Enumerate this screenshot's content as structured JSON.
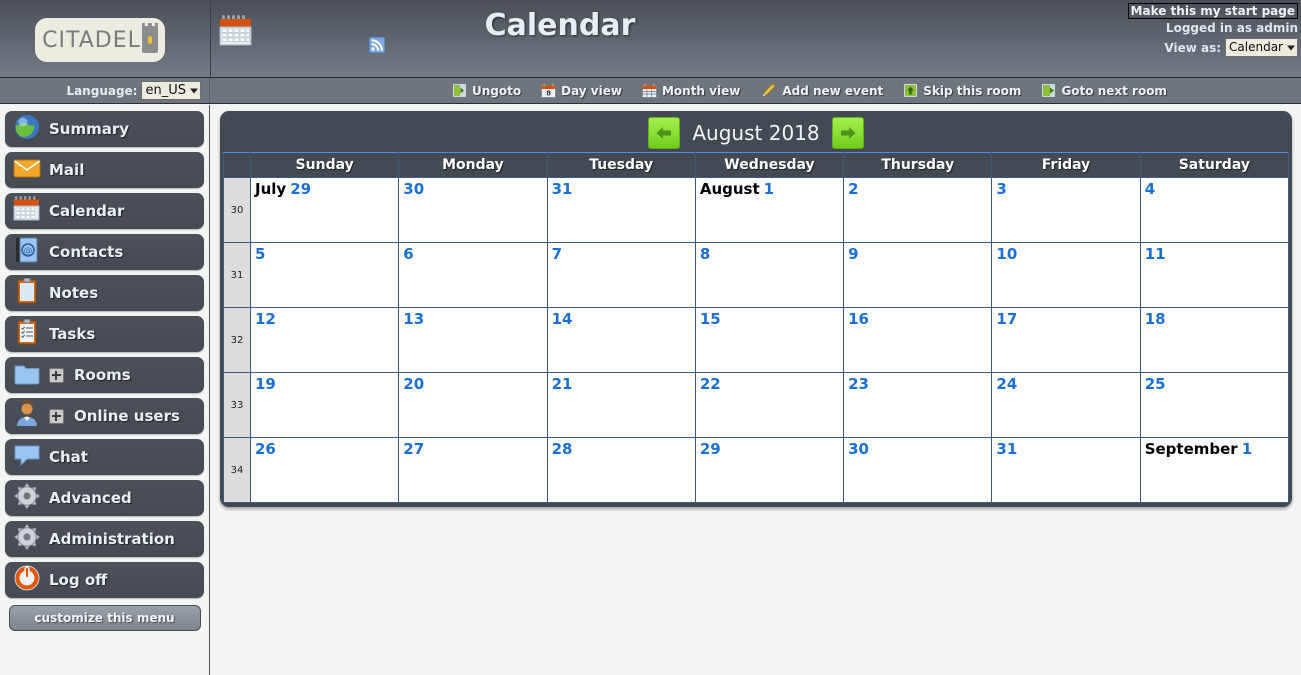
{
  "banner": {
    "logo_text": "CITADEL",
    "calendar_icon": "calendar-icon",
    "title": "Calendar",
    "rss_icon": "rss-icon",
    "start_page_link": "Make this my start page",
    "logged_in_text": "Logged in as admin",
    "view_as_label": "View as:",
    "view_as_value": "Calendar"
  },
  "strip": {
    "language_label": "Language:",
    "language_value": "en_US",
    "toolbar": [
      {
        "label": "Ungoto",
        "icon": "ungoto-icon"
      },
      {
        "label": "Day view",
        "icon": "day-view-icon"
      },
      {
        "label": "Month view",
        "icon": "month-view-icon"
      },
      {
        "label": "Add new event",
        "icon": "pencil-icon"
      },
      {
        "label": "Skip this room",
        "icon": "skip-room-icon"
      },
      {
        "label": "Goto next room",
        "icon": "next-room-icon"
      }
    ]
  },
  "sidebar": {
    "items": [
      {
        "label": "Summary",
        "icon": "globe-icon",
        "expandable": false
      },
      {
        "label": "Mail",
        "icon": "envelope-icon",
        "expandable": false
      },
      {
        "label": "Calendar",
        "icon": "calendar-icon",
        "expandable": false
      },
      {
        "label": "Contacts",
        "icon": "address-book-icon",
        "expandable": false
      },
      {
        "label": "Notes",
        "icon": "clipboard-icon",
        "expandable": false
      },
      {
        "label": "Tasks",
        "icon": "checklist-icon",
        "expandable": false
      },
      {
        "label": "Rooms",
        "icon": "folder-icon",
        "expandable": true
      },
      {
        "label": "Online users",
        "icon": "user-icon",
        "expandable": true
      },
      {
        "label": "Chat",
        "icon": "chat-bubble-icon",
        "expandable": false
      },
      {
        "label": "Advanced",
        "icon": "gear-icon",
        "expandable": false
      },
      {
        "label": "Administration",
        "icon": "gear-icon",
        "expandable": false
      },
      {
        "label": "Log off",
        "icon": "power-icon",
        "expandable": false
      }
    ],
    "customize_label": "customize this menu"
  },
  "calendar": {
    "title": "August 2018",
    "prev_icon": "arrow-left-icon",
    "next_icon": "arrow-right-icon",
    "weeknum_header": "",
    "day_headers": [
      "Sunday",
      "Monday",
      "Tuesday",
      "Wednesday",
      "Thursday",
      "Friday",
      "Saturday"
    ],
    "weeks": [
      {
        "number": "30",
        "days": [
          {
            "month": "July",
            "day": "29",
            "state": "othermonth"
          },
          {
            "month": "",
            "day": "30",
            "state": "othermonth"
          },
          {
            "month": "",
            "day": "31",
            "state": "othermonth"
          },
          {
            "month": "August",
            "day": "1",
            "state": "normal"
          },
          {
            "month": "",
            "day": "2",
            "state": "normal"
          },
          {
            "month": "",
            "day": "3",
            "state": "normal"
          },
          {
            "month": "",
            "day": "4",
            "state": "weekend"
          }
        ]
      },
      {
        "number": "31",
        "days": [
          {
            "month": "",
            "day": "5",
            "state": "weekend"
          },
          {
            "month": "",
            "day": "6",
            "state": "normal"
          },
          {
            "month": "",
            "day": "7",
            "state": "normal"
          },
          {
            "month": "",
            "day": "8",
            "state": "normal"
          },
          {
            "month": "",
            "day": "9",
            "state": "normal"
          },
          {
            "month": "",
            "day": "10",
            "state": "normal"
          },
          {
            "month": "",
            "day": "11",
            "state": "weekend"
          }
        ]
      },
      {
        "number": "32",
        "days": [
          {
            "month": "",
            "day": "12",
            "state": "weekend"
          },
          {
            "month": "",
            "day": "13",
            "state": "normal"
          },
          {
            "month": "",
            "day": "14",
            "state": "normal"
          },
          {
            "month": "",
            "day": "15",
            "state": "normal"
          },
          {
            "month": "",
            "day": "16",
            "state": "normal"
          },
          {
            "month": "",
            "day": "17",
            "state": "normal"
          },
          {
            "month": "",
            "day": "18",
            "state": "weekend"
          }
        ]
      },
      {
        "number": "33",
        "days": [
          {
            "month": "",
            "day": "19",
            "state": "weekend"
          },
          {
            "month": "",
            "day": "20",
            "state": "normal"
          },
          {
            "month": "",
            "day": "21",
            "state": "normal"
          },
          {
            "month": "",
            "day": "22",
            "state": "normal"
          },
          {
            "month": "",
            "day": "23",
            "state": "normal"
          },
          {
            "month": "",
            "day": "24",
            "state": "normal"
          },
          {
            "month": "",
            "day": "25",
            "state": "weekend"
          }
        ]
      },
      {
        "number": "34",
        "days": [
          {
            "month": "",
            "day": "26",
            "state": "weekend"
          },
          {
            "month": "",
            "day": "27",
            "state": "normal"
          },
          {
            "month": "",
            "day": "28",
            "state": "normal"
          },
          {
            "month": "",
            "day": "29",
            "state": "normal"
          },
          {
            "month": "",
            "day": "30",
            "state": "normal"
          },
          {
            "month": "",
            "day": "31",
            "state": "today"
          },
          {
            "month": "September",
            "day": "1",
            "state": "othermonth"
          }
        ]
      }
    ]
  },
  "colors": {
    "banner_dark": "#4a4f57",
    "banner_light": "#767c85",
    "nav_item": "#454a53",
    "accent_blue": "#1c6fd4",
    "weekend_bg": "#e9e8c8",
    "othermonth_bg": "#d9d9d9",
    "today_bg": "#e8ebfb",
    "arrow_green": "#72cc1c",
    "grid_border": "#3c5a80"
  }
}
